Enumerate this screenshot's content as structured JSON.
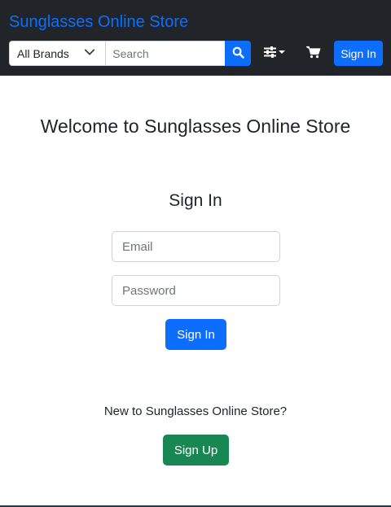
{
  "navbar": {
    "brand": "Sunglasses Online Store",
    "brand_filter": {
      "selected": "All Brands"
    },
    "search": {
      "placeholder": "Search",
      "value": ""
    },
    "icons": {
      "search": "search-icon",
      "filter": "sliders-icon",
      "cart": "cart-icon",
      "dropdown": "chevron-down-icon"
    },
    "signin_label": "Sign In"
  },
  "main": {
    "welcome": "Welcome to Sunglasses Online Store",
    "signin_heading": "Sign In",
    "email_placeholder": "Email",
    "password_placeholder": "Password",
    "signin_button": "Sign In",
    "new_text": "New to Sunglasses Online Store?",
    "signup_button": "Sign Up"
  },
  "colors": {
    "navbar_bg": "#212529",
    "primary": "#0d6efd",
    "success": "#198754"
  }
}
